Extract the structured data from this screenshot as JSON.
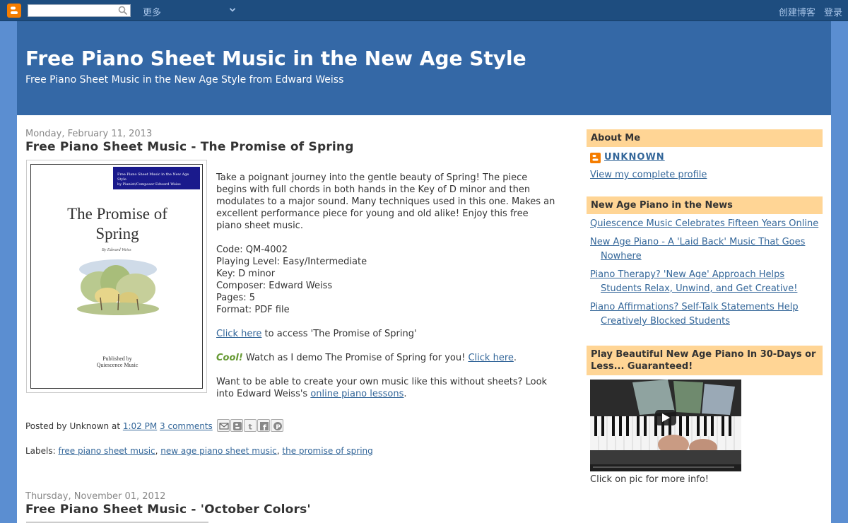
{
  "navbar": {
    "logo_icon": "blogger-icon",
    "search_placeholder": "",
    "search_icon": "search-icon",
    "more_label": "更多",
    "create_blog_label": "创建博客",
    "sign_in_label": "登录"
  },
  "header": {
    "title": "Free Piano Sheet Music in the New Age Style",
    "description": "Free Piano Sheet Music in the New Age Style from Edward Weiss"
  },
  "post1": {
    "date": "Monday, February 11, 2013",
    "title": "Free Piano Sheet Music - The Promise of Spring",
    "cover": {
      "band_line1": "Free Piano Sheet Music in the New Age Style",
      "band_line2": "by Pianist/Composer Edward Weiss",
      "title_line1": "The Promise of",
      "title_line2": "Spring",
      "author": "By Edward Weiss",
      "published_line1": "Published by",
      "published_line2": "Quiescence Music"
    },
    "intro": "Take a poignant journey into the gentle beauty of Spring! The piece begins with full chords in both hands in the Key of D minor and then modulates to a major sound. Many techniques used in this one. Makes an excellent performance piece for young and old alike! Enjoy this free piano sheet music.",
    "specs": [
      "Code: QM-4002",
      "Playing Level: Easy/Intermediate",
      "Key: D minor",
      "Composer: Edward Weiss",
      "Pages: 5",
      "Format: PDF file"
    ],
    "access_link": "Click here",
    "access_text": " to access 'The Promise of Spring'",
    "cool_label": "Cool!",
    "demo_text": " Watch as I demo The Promise of Spring for you! ",
    "demo_link": "Click here",
    "demo_end": ".",
    "lessons_text1": "Want to be able to create your own music like this without sheets? Look into Edward Weiss's ",
    "lessons_link": "online piano lessons",
    "lessons_end": ".",
    "footer_prefix": "Posted by Unknown at ",
    "time": "1:02 PM",
    "comments": "3 comments",
    "share_icons": [
      "email-icon",
      "blogthis-icon",
      "twitter-icon",
      "facebook-icon",
      "pinterest-icon"
    ],
    "labels_prefix": "Labels: ",
    "labels": [
      "free piano sheet music",
      "new age piano sheet music",
      "the promise of spring"
    ]
  },
  "post2": {
    "date": "Thursday, November 01, 2012",
    "title": "Free Piano Sheet Music - 'October Colors'"
  },
  "sidebar": {
    "about_title": "About Me",
    "profile_name": "UNKNOWN",
    "profile_link": "View my complete profile",
    "news_title": "New Age Piano in the News",
    "news_items": [
      "Quiescence Music Celebrates Fifteen Years Online",
      "New Age Piano - A 'Laid Back' Music That Goes Nowhere",
      "Piano Therapy? 'New Age' Approach Helps Students Relax, Unwind, and Get Creative!",
      "Piano Affirmations? Self-Talk Statements Help Creatively Blocked Students"
    ],
    "promo_title": "Play Beautiful New Age Piano In 30-Days or Less... Guaranteed!",
    "video_caption": "Click on pic for more info!"
  },
  "colors": {
    "navbar": "#1e4d7f",
    "header": "#3468a6",
    "outer": "#5b8ed1",
    "widget_header": "#ffd595",
    "link": "#336699",
    "cool": "#669933"
  }
}
